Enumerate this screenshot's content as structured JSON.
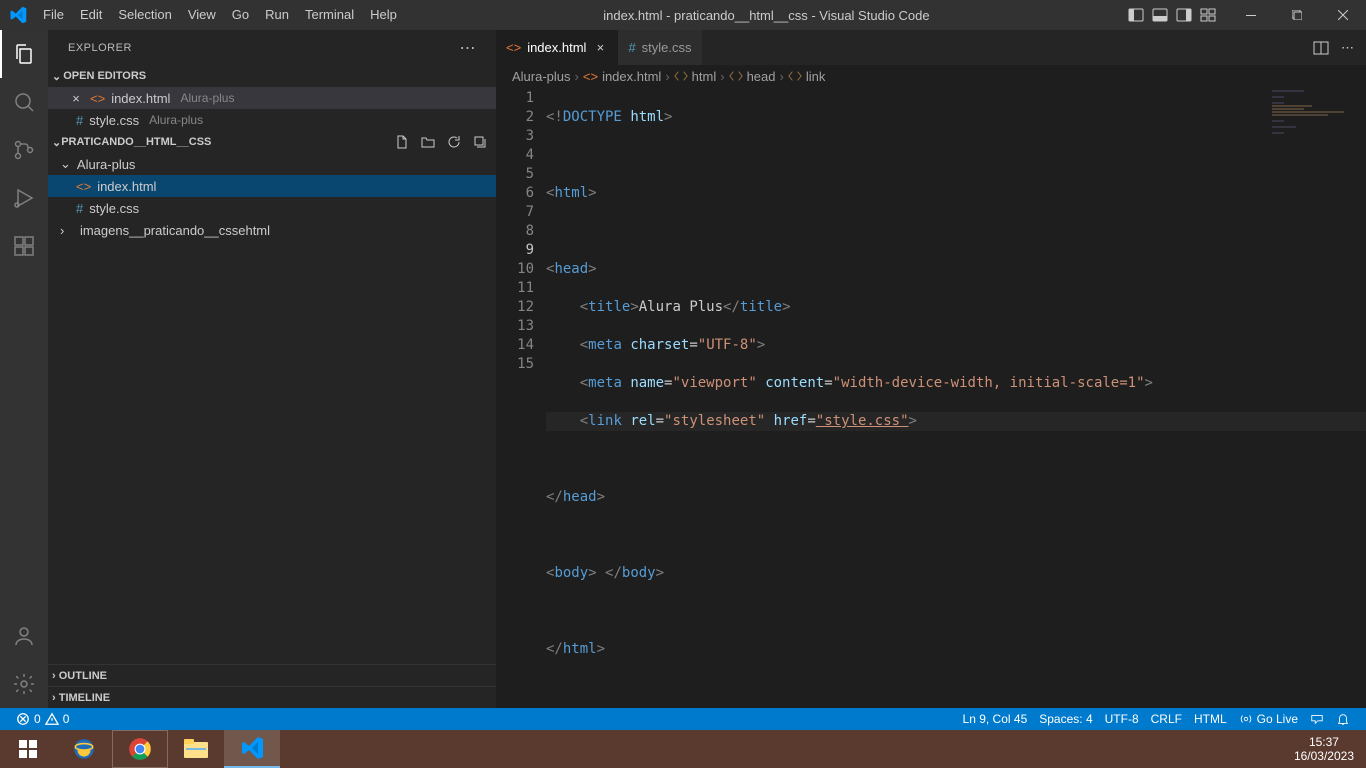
{
  "titlebar": {
    "menu": [
      "File",
      "Edit",
      "Selection",
      "View",
      "Go",
      "Run",
      "Terminal",
      "Help"
    ],
    "title": "index.html - praticando__html__css - Visual Studio Code"
  },
  "explorer": {
    "title": "EXPLORER",
    "open_editors_label": "OPEN EDITORS",
    "open_editors": [
      {
        "name": "index.html",
        "dir": "Alura-plus",
        "icon": "html",
        "active": true
      },
      {
        "name": "style.css",
        "dir": "Alura-plus",
        "icon": "css",
        "active": false
      }
    ],
    "project_name": "PRATICANDO__HTML__CSS",
    "tree": {
      "folder": "Alura-plus",
      "files": [
        {
          "name": "index.html",
          "icon": "html",
          "selected": true
        },
        {
          "name": "style.css",
          "icon": "css",
          "selected": false
        }
      ],
      "folder2": "imagens__praticando__cssehtml"
    },
    "outline_label": "OUTLINE",
    "timeline_label": "TIMELINE"
  },
  "tabs": [
    {
      "name": "index.html",
      "icon": "html",
      "active": true,
      "closeable": true
    },
    {
      "name": "style.css",
      "icon": "css",
      "active": false,
      "closeable": false
    }
  ],
  "breadcrumb": [
    "Alura-plus",
    "index.html",
    "html",
    "head",
    "link"
  ],
  "code": {
    "lines": 15,
    "current": 9
  },
  "statusbar": {
    "errors": "0",
    "warnings": "0",
    "ln_col": "Ln 9, Col 45",
    "spaces": "Spaces: 4",
    "enc": "UTF-8",
    "eol": "CRLF",
    "lang": "HTML",
    "golive": "Go Live"
  },
  "clock": {
    "time": "15:37",
    "date": "16/03/2023"
  }
}
